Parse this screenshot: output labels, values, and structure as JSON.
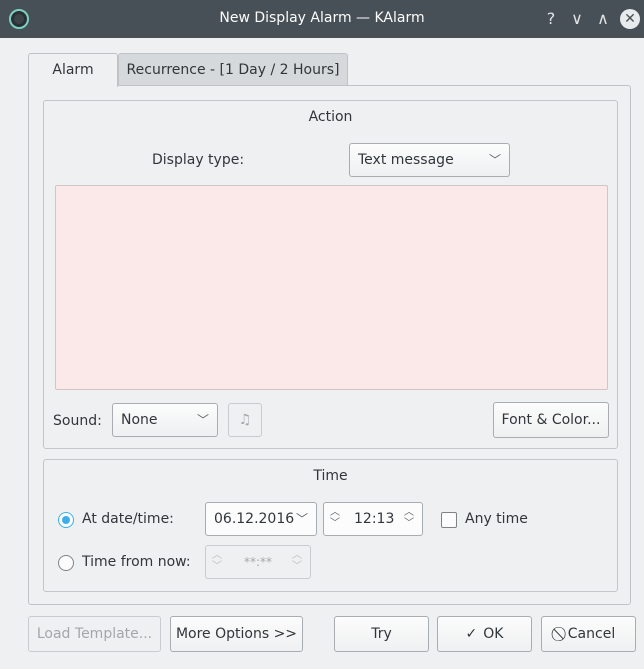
{
  "window": {
    "title": "New Display Alarm — KAlarm",
    "help_glyph": "?",
    "minimize_glyph": "∨",
    "maximize_glyph": "∧",
    "close_glyph": "✕"
  },
  "tabs": [
    {
      "label": "Alarm"
    },
    {
      "label": "Recurrence - [1 Day / 2 Hours]"
    }
  ],
  "action": {
    "title": "Action",
    "display_type_label": "Display type:",
    "display_type_value": "Text message",
    "message_text": "",
    "message_bg": "#fbe8e8",
    "sound_label": "Sound:",
    "sound_value": "None",
    "font_color_label": "Font & Color..."
  },
  "time": {
    "title": "Time",
    "at_datetime_label": "At date/time:",
    "date_value": "06.12.2016",
    "time_value": "12:13",
    "any_time_label": "Any time",
    "time_from_now_label": "Time from now:",
    "time_from_now_value": "**:**"
  },
  "buttons": {
    "load_template": "Load Template...",
    "more_options": "More Options >>",
    "try": "Try",
    "ok": "OK",
    "cancel": "Cancel"
  },
  "colors": {
    "accent": "#3daee9",
    "titlebar": "#475057"
  }
}
